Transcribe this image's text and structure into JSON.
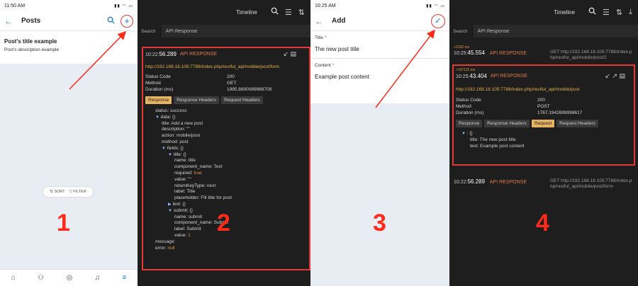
{
  "panel1": {
    "time": "11:50 AM",
    "title": "Posts",
    "post_title": "Post's title example",
    "post_desc": "Post's description example",
    "sort": "SORT",
    "filter": "FILTER",
    "step": "1"
  },
  "panel2": {
    "header": "Timeline",
    "search_label": "Search",
    "search_value": "API Response",
    "time_prefix": "10:22:",
    "time_main": "56.289",
    "api_label": "API RESPONSE",
    "url": "http://192.168.18.105:7788/index.php/restful_api/mobile/post/form",
    "status_code_label": "Status Code",
    "status_code": "200",
    "method_label": "Method",
    "method": "GET",
    "duration_label": "Duration (ms)",
    "duration": "1995.8890089988708",
    "tabs": [
      "Response",
      "Response Headers",
      "Request Headers"
    ],
    "tree": [
      {
        "indent": 0,
        "arrow": "",
        "key": "status:",
        "val": "success",
        "cls": "vg"
      },
      {
        "indent": 0,
        "arrow": "▼",
        "key": "data:",
        "val": "{}",
        "cls": "vg"
      },
      {
        "indent": 1,
        "arrow": "",
        "key": "title:",
        "val": "Add a new post",
        "cls": "vg"
      },
      {
        "indent": 1,
        "arrow": "",
        "key": "description:",
        "val": "\"\"",
        "cls": "vg"
      },
      {
        "indent": 1,
        "arrow": "",
        "key": "action:",
        "val": "mobile/post",
        "cls": "vg"
      },
      {
        "indent": 1,
        "arrow": "",
        "key": "method:",
        "val": "post",
        "cls": "vg"
      },
      {
        "indent": 1,
        "arrow": "▼",
        "key": "fields:",
        "val": "{}",
        "cls": "vg"
      },
      {
        "indent": 2,
        "arrow": "▼",
        "key": "title:",
        "val": "{}",
        "cls": "vg"
      },
      {
        "indent": 3,
        "arrow": "",
        "key": "name:",
        "val": "title",
        "cls": "vg"
      },
      {
        "indent": 3,
        "arrow": "",
        "key": "component_name:",
        "val": "Text",
        "cls": "vg"
      },
      {
        "indent": 3,
        "arrow": "",
        "key": "required:",
        "val": "true",
        "cls": "vr"
      },
      {
        "indent": 3,
        "arrow": "",
        "key": "value:",
        "val": "\"\"",
        "cls": "vg"
      },
      {
        "indent": 3,
        "arrow": "",
        "key": "returnKeyType:",
        "val": "next",
        "cls": "vg"
      },
      {
        "indent": 3,
        "arrow": "",
        "key": "label:",
        "val": "Title",
        "cls": "vg"
      },
      {
        "indent": 3,
        "arrow": "",
        "key": "placeholder:",
        "val": "Fill title for post",
        "cls": "vg"
      },
      {
        "indent": 2,
        "arrow": "▶",
        "key": "text:",
        "val": "{}",
        "cls": "vg"
      },
      {
        "indent": 2,
        "arrow": "▼",
        "key": "submit:",
        "val": "{}",
        "cls": "vg"
      },
      {
        "indent": 3,
        "arrow": "",
        "key": "name:",
        "val": "submit",
        "cls": "vg"
      },
      {
        "indent": 3,
        "arrow": "",
        "key": "component_name:",
        "val": "Submit",
        "cls": "vg"
      },
      {
        "indent": 3,
        "arrow": "",
        "key": "label:",
        "val": "Submit",
        "cls": "vg"
      },
      {
        "indent": 3,
        "arrow": "",
        "key": "value:",
        "val": "1",
        "cls": "vr"
      },
      {
        "indent": 0,
        "arrow": "",
        "key": "message:",
        "val": "",
        "cls": "vg"
      },
      {
        "indent": 0,
        "arrow": "",
        "key": "error:",
        "val": "null",
        "cls": "vr"
      }
    ],
    "step": "2"
  },
  "panel3": {
    "time": "10:25 AM",
    "title": "Add",
    "title_label": "Title",
    "title_value": "The new post title",
    "content_label": "Content",
    "content_value": "Example post content",
    "req": "*",
    "step": "3"
  },
  "panel4": {
    "header": "Timeline",
    "search_label": "Search",
    "search_value": "API Response",
    "e1_delta": "+2150 ms",
    "e1_prefix": "10:25:",
    "e1_time": "45.554",
    "e1_label": "API RESPONSE",
    "e1_url": "GET http://192.168.18.105:7788/index.php/restful_api/mobile/post/2",
    "e2_delta": "+157115 ms",
    "e2_prefix": "10:25:",
    "e2_time": "43.404",
    "e2_label": "API RESPONSE",
    "e2_url": "http://192.168.18.105:7788/index.php/restful_api/mobile/post",
    "status_code_label": "Status Code",
    "status_code": "200",
    "method_label": "Method",
    "method": "POST",
    "duration_label": "Duration (ms)",
    "duration": "1767.1942699998617",
    "tabs": [
      "Response",
      "Response Headers",
      "Request",
      "Request Headers"
    ],
    "req_title_key": "title:",
    "req_title_val": "The new post title",
    "req_text_key": "text:",
    "req_text_val": "Example post content",
    "e3_prefix": "10:22:",
    "e3_time": "56.289",
    "e3_label": "API RESPONSE",
    "e3_url": "GET http://192.168.18.105:7788/index.php/restful_api/mobile/post/form",
    "step": "4"
  }
}
